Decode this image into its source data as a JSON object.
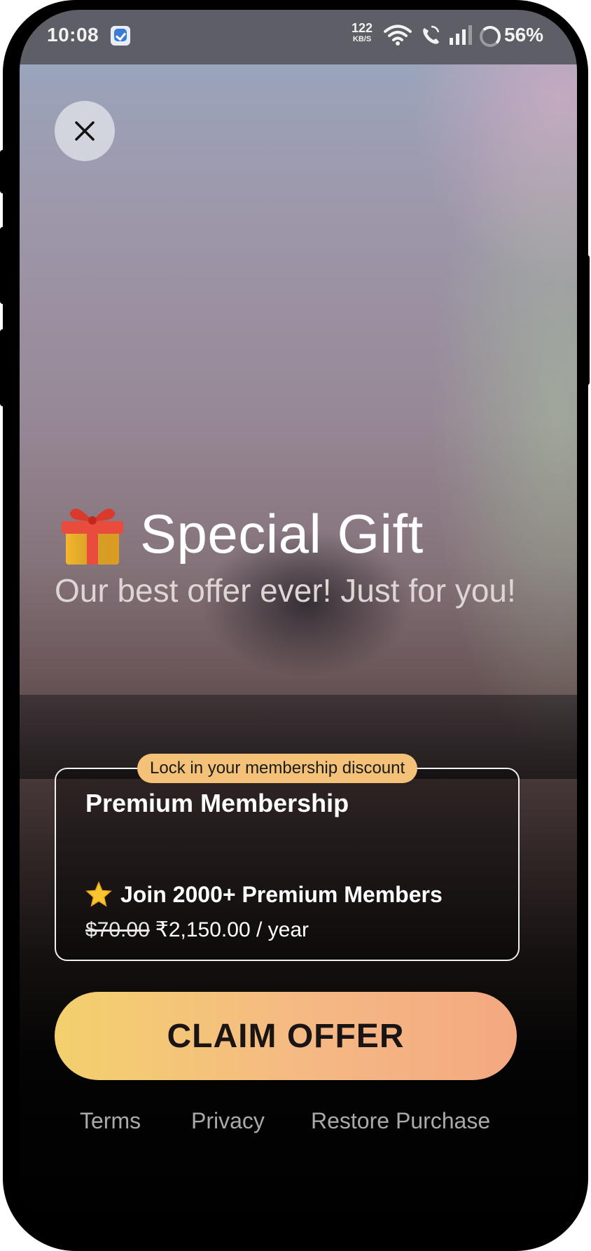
{
  "status_bar": {
    "time": "10:08",
    "net_speed_value": "122",
    "net_speed_unit": "KB/S",
    "battery": "56%"
  },
  "hero": {
    "title": "Special Gift",
    "subtitle": "Our best offer ever! Just for you!",
    "gift_icon": "gift-icon"
  },
  "plan": {
    "badge": "Lock in your membership discount",
    "name": "Premium Membership",
    "members": "Join 2000+ Premium Members",
    "old_price": "$70.00",
    "price": "₹2,150.00 / year"
  },
  "cta": {
    "label": "CLAIM OFFER"
  },
  "footer": {
    "terms": "Terms",
    "privacy": "Privacy",
    "restore": "Restore Purchase"
  },
  "colors": {
    "cta_start": "#f3d06d",
    "cta_end": "#f4a880",
    "badge": "#f3c177",
    "footer_text": "#a9a9ae"
  }
}
